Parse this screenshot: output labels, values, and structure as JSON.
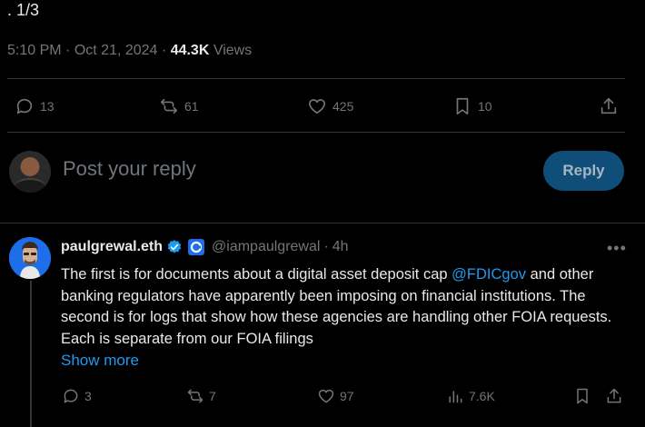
{
  "thread_marker": ". 1/3",
  "post_meta": {
    "time": "5:10 PM",
    "date": "Oct 21, 2024",
    "separator": "·",
    "views_count": "44.3K",
    "views_label": "Views"
  },
  "main_actions": {
    "replies": "13",
    "reposts": "61",
    "likes": "425",
    "bookmarks": "10"
  },
  "composer": {
    "placeholder": "Post your reply",
    "reply_button": "Reply"
  },
  "reply_tweet": {
    "display_name": "paulgrewal.eth",
    "handle": "@iampaulgrewal",
    "separator": "·",
    "time": "4h",
    "text_before_mention": "The first is for documents about a digital asset deposit cap ",
    "mention": "@FDICgov",
    "text_after_mention": " and other banking regulators have apparently been imposing on financial institutions. The second is for logs that show how these agencies are handling other FOIA requests. Each is separate from our FOIA filings",
    "show_more": "Show more",
    "actions": {
      "replies": "3",
      "reposts": "7",
      "likes": "97",
      "views": "7.6K"
    }
  },
  "colors": {
    "background": "#000000",
    "text": "#e7e9ea",
    "muted": "#71767b",
    "accent": "#1d9bf0",
    "divider": "#2f3336",
    "reply_button_bg": "#0f4e78"
  }
}
